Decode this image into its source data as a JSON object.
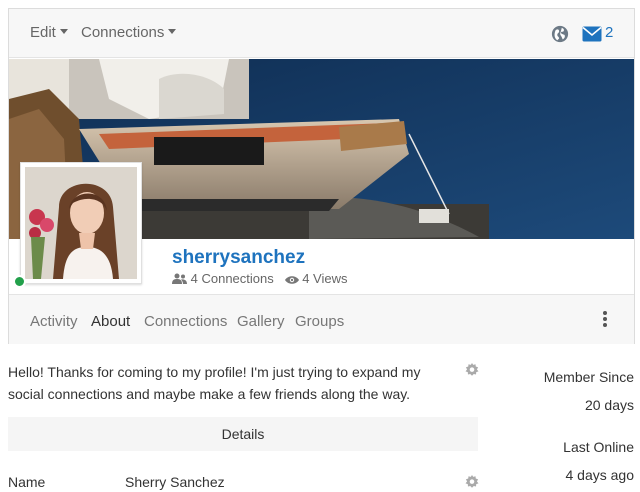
{
  "toolbar": {
    "edit_label": "Edit",
    "connections_label": "Connections",
    "mail_count": "2"
  },
  "profile": {
    "username": "sherrysanchez",
    "connections_text": "4 Connections",
    "views_text": "4 Views"
  },
  "tabs": [
    {
      "label": "Activity",
      "active": false
    },
    {
      "label": "About",
      "active": true
    },
    {
      "label": "Connections",
      "active": false
    },
    {
      "label": "Gallery",
      "active": false
    },
    {
      "label": "Groups",
      "active": false
    }
  ],
  "about": {
    "bio": "Hello! Thanks for coming to my profile! I'm just trying to expand my social connections and maybe make a few friends along the way.",
    "details_header": "Details",
    "fields": [
      {
        "label": "Name",
        "value": "Sherry Sanchez"
      }
    ]
  },
  "sidebar": {
    "member_since_label": "Member Since",
    "member_since_value": "20 days",
    "last_online_label": "Last Online",
    "last_online_value": "4 days ago"
  },
  "colors": {
    "link": "#1e73be",
    "online": "#22a04b"
  },
  "icons": [
    "chevron-down-icon",
    "globe-icon",
    "envelope-icon",
    "users-icon",
    "eye-icon",
    "kebab-menu-icon",
    "gear-icon"
  ]
}
